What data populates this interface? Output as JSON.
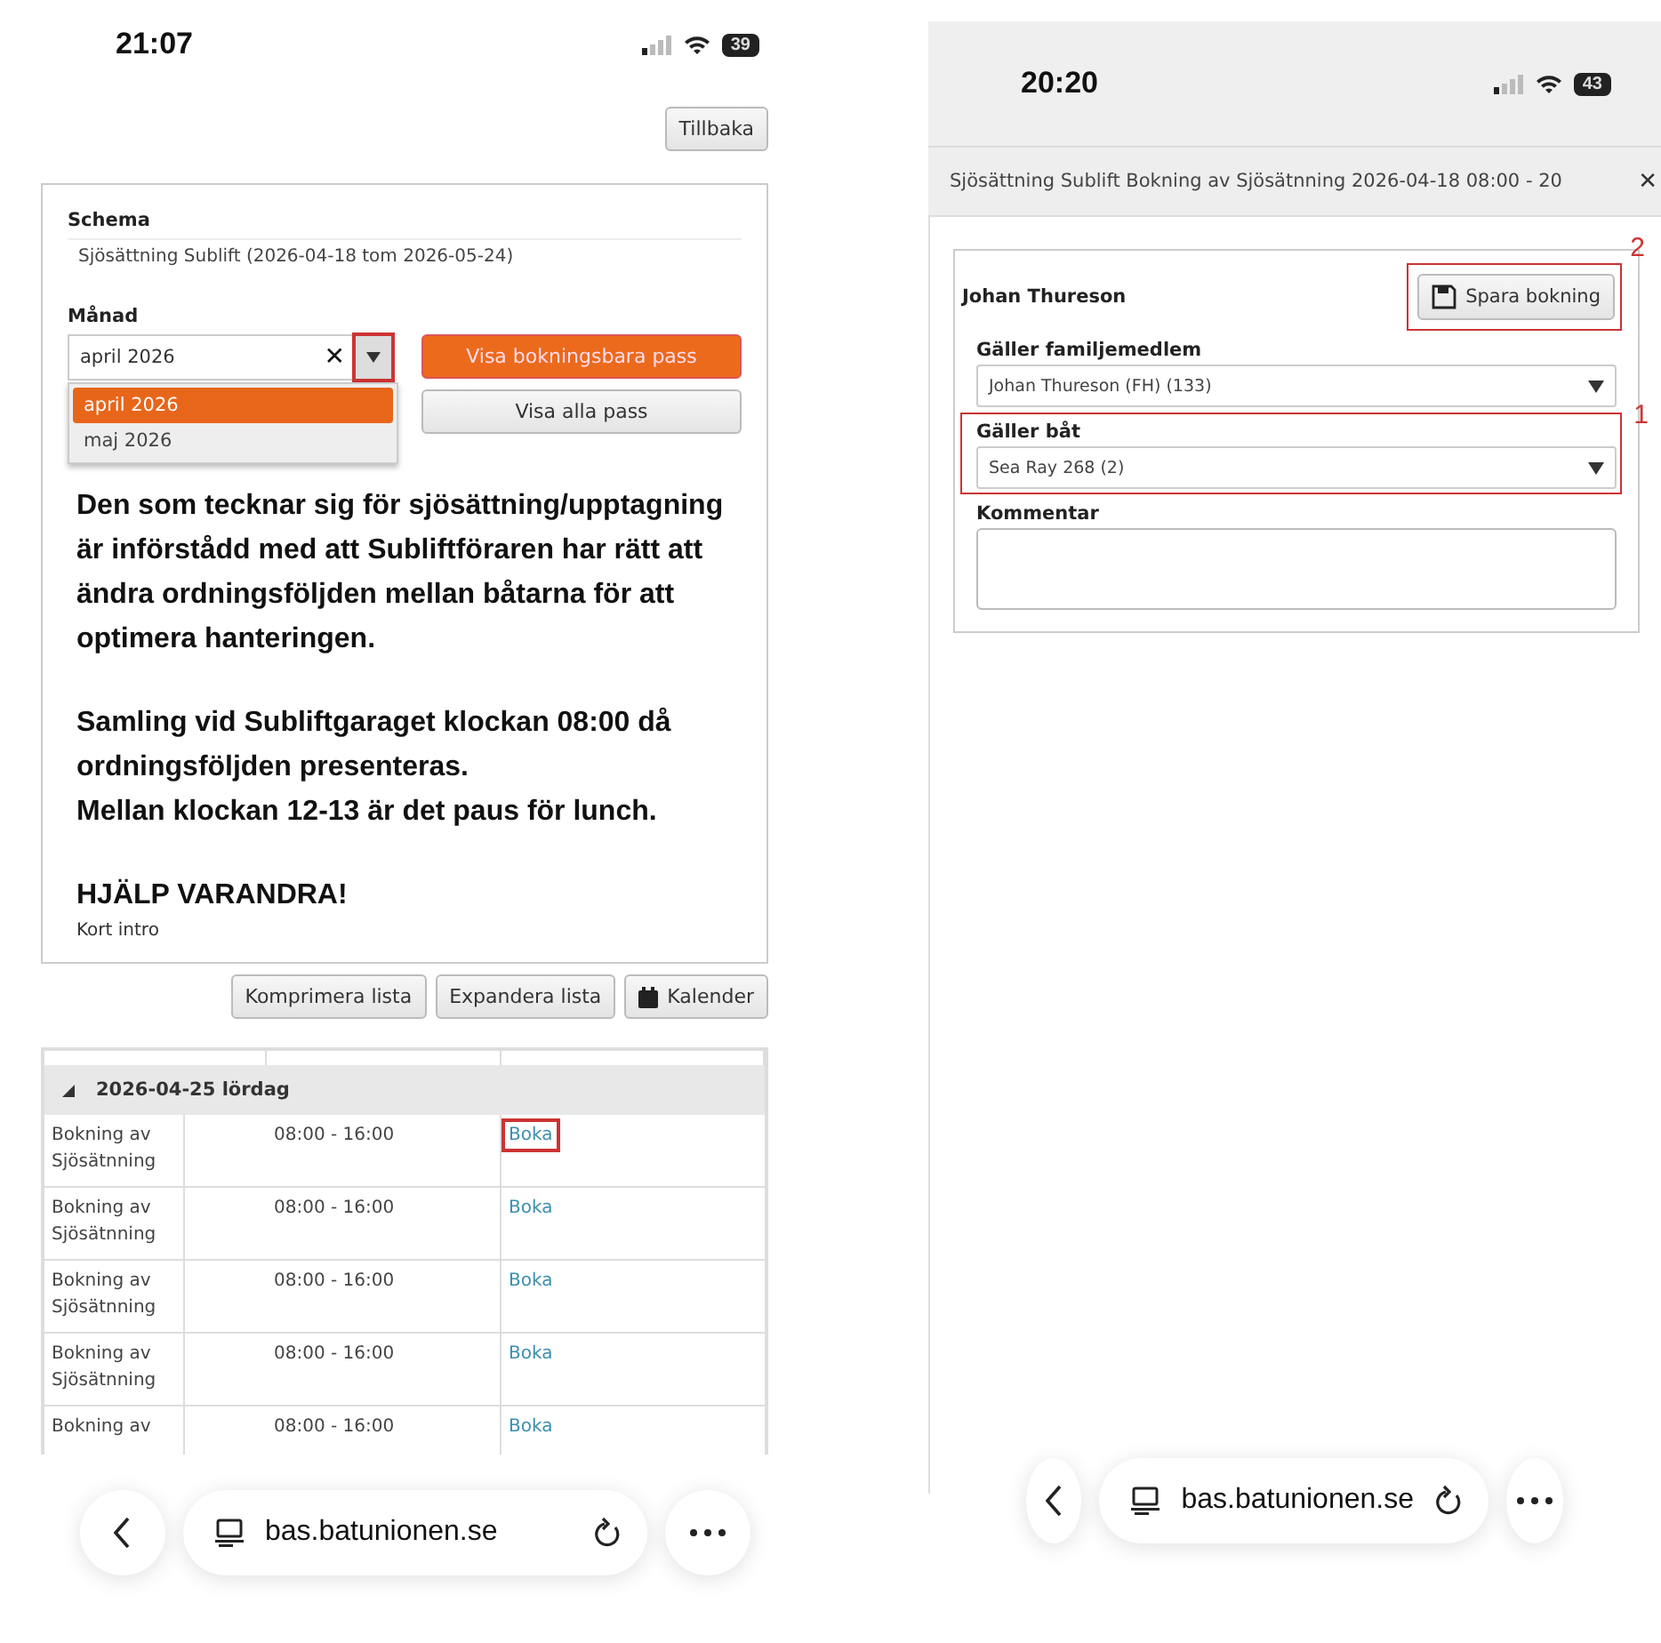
{
  "left_screen": {
    "status_bar": {
      "time": "21:07",
      "battery": "39"
    },
    "back_button": "Tillbaka",
    "schema": {
      "label": "Schema",
      "value": "Sjösättning Sublift (2026-04-18 tom 2026-05-24)"
    },
    "month": {
      "label": "Månad",
      "value": "april 2026",
      "clear": "✕",
      "highlighted": true,
      "options": [
        {
          "label": "april 2026",
          "selected": true
        },
        {
          "label": "maj 2026",
          "selected": false
        }
      ]
    },
    "buttons": [
      {
        "label": "Visa bokningsbara pass",
        "kind": "primary"
      },
      {
        "label": "Visa alla pass",
        "kind": "secondary"
      }
    ],
    "info": [
      "Den som tecknar sig för sjösättning/upptagning är införstådd med att Subliftföraren har rätt att ändra ordningsföljden mellan båtarna för att optimera hanteringen.",
      "Samling vid Subliftgaraget klockan 08:00 då ordningsföljden presenteras.\nMellan klockan 12-13 är det paus för lunch.",
      "HJÄLP VARANDRA!"
    ],
    "intro": "Kort intro",
    "list_buttons": [
      {
        "label": "Komprimera lista",
        "kind": "text"
      },
      {
        "label": "Expandera lista",
        "kind": "text"
      },
      {
        "label": "Kalender",
        "kind": "calendar"
      }
    ],
    "table": {
      "group": {
        "label": "2026-04-25 lördag",
        "expanded": true
      },
      "rows": [
        {
          "activity": "Bokning av Sjösätnning",
          "time": "08:00 - 16:00",
          "action": "Boka",
          "highlighted": true
        },
        {
          "activity": "Bokning av Sjösätnning",
          "time": "08:00 - 16:00",
          "action": "Boka",
          "highlighted": false
        },
        {
          "activity": "Bokning av Sjösätnning",
          "time": "08:00 - 16:00",
          "action": "Boka",
          "highlighted": false
        },
        {
          "activity": "Bokning av Sjösätnning",
          "time": "08:00 - 16:00",
          "action": "Boka",
          "highlighted": false
        },
        {
          "activity": "Bokning av",
          "time": "08:00 - 16:00",
          "action": "Boka",
          "highlighted": false
        }
      ]
    },
    "browser_bar": {
      "url": "bas.batunionen.se"
    }
  },
  "right_screen": {
    "status_bar": {
      "time": "20:20",
      "battery": "43"
    },
    "dialog": {
      "title": "Sjösättning Sublift Bokning av Sjösätnning 2026-04-18 08:00 - 20",
      "close": "✕",
      "member_name": "Johan Thureson",
      "save_button": {
        "label": "Spara bokning",
        "highlighted": true,
        "annotation": "2"
      },
      "fields": [
        {
          "label": "Gäller familjemedlem",
          "value": "Johan Thureson (FH) (133)",
          "kind": "select",
          "highlighted": false
        },
        {
          "label": "Gäller båt",
          "value": "Sea Ray 268 (2)",
          "kind": "select",
          "highlighted": true,
          "annotation": "1"
        },
        {
          "label": "Kommentar",
          "kind": "textarea",
          "highlighted": false
        }
      ]
    },
    "browser_bar": {
      "url": "bas.batunionen.se"
    }
  }
}
